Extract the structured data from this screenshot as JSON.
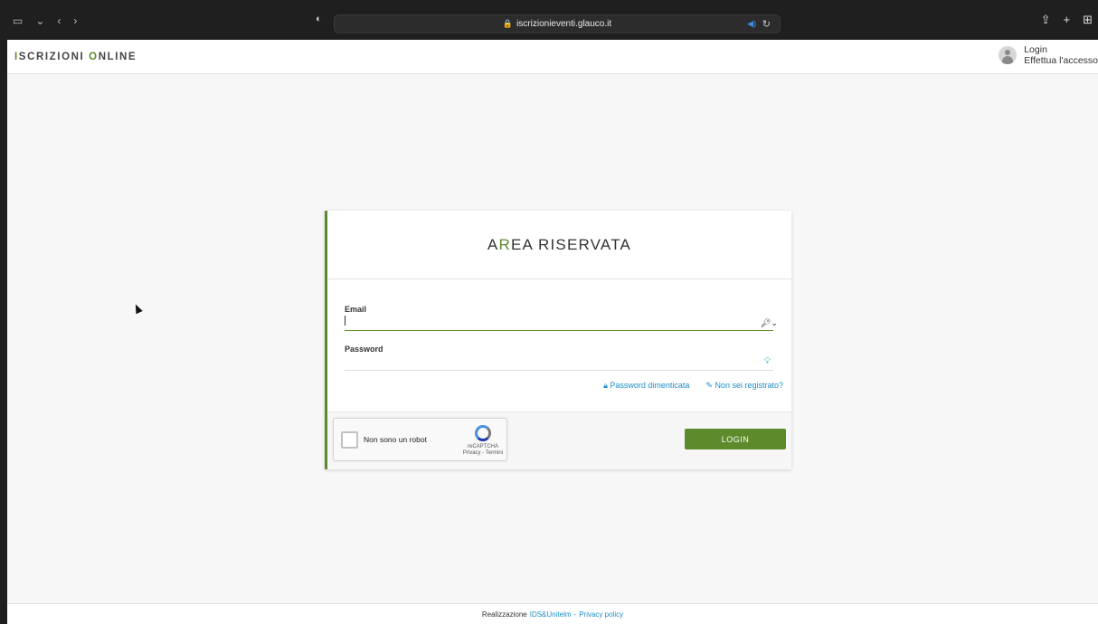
{
  "browser": {
    "url": "iscrizionieventi.glauco.it"
  },
  "header": {
    "brand_first_letter": "I",
    "brand_rest_1": "SCRIZIONI ",
    "brand_highlight": "O",
    "brand_rest_2": "NLINE",
    "user_title": "Login",
    "user_subtitle": "Effettua l'accesso"
  },
  "card": {
    "title_first": "A",
    "title_highlight": "R",
    "title_rest": "EA RISERVATA",
    "email_label": "Email",
    "email_value": "",
    "password_label": "Password",
    "password_value": "",
    "forgot_password": "Password dimenticata",
    "register": "Non sei registrato?",
    "recaptcha_label": "Non sono un robot",
    "recaptcha_brand": "reCAPTCHA",
    "recaptcha_links": "Privacy - Termini",
    "login_button": "LOGIN"
  },
  "footer": {
    "prefix": "Realizzazione",
    "author": "IDS&Unitelm",
    "separator": "-",
    "privacy": "Privacy policy"
  },
  "colors": {
    "accent": "#5d8a2a",
    "link": "#1d8fc6"
  }
}
